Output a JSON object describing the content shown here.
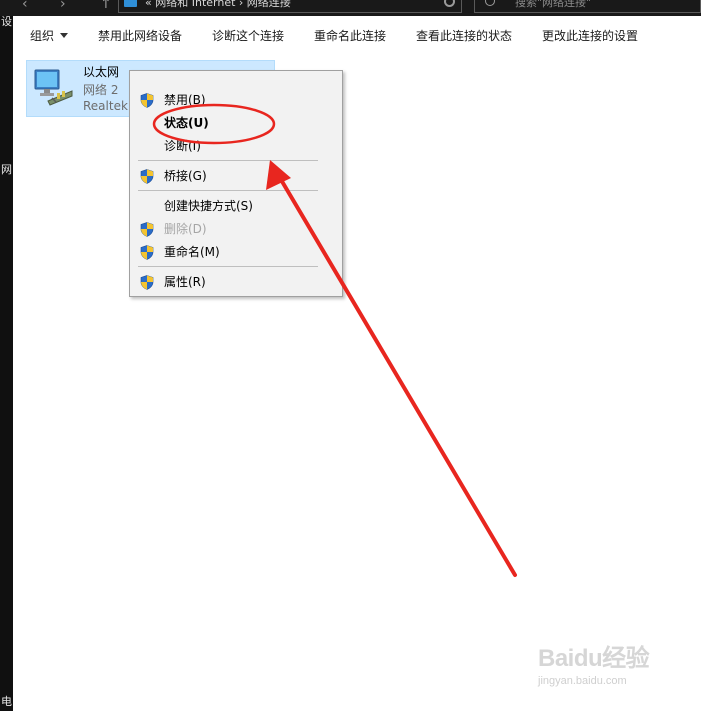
{
  "window": {
    "breadcrumb": "« 网络和 Internet › 网络连接",
    "search_placeholder": "搜索\"网络连接\"",
    "nav_back": "‹",
    "nav_forward": "›",
    "nav_up": "↑"
  },
  "left_strip": [
    "设",
    "网",
    "电"
  ],
  "toolbar": {
    "organize": "组织",
    "disable": "禁用此网络设备",
    "diagnose": "诊断这个连接",
    "rename": "重命名此连接",
    "view_status": "查看此连接的状态",
    "change_settings": "更改此连接的设置"
  },
  "adapter": {
    "name": "以太网",
    "network": "网络 2",
    "device": "Realtek PC"
  },
  "context_menu": {
    "items": [
      {
        "label": "禁用(B)",
        "icon": "uac-shield-icon"
      },
      {
        "label": "状态(U)"
      },
      {
        "label": "诊断(I)"
      },
      {
        "label": "桥接(G)",
        "icon": "uac-shield-icon"
      },
      {
        "label": "创建快捷方式(S)"
      },
      {
        "label": "删除(D)",
        "icon": "uac-shield-icon"
      },
      {
        "label": "重命名(M)",
        "icon": "uac-shield-icon"
      },
      {
        "label": "属性(R)",
        "icon": "uac-shield-icon"
      }
    ]
  },
  "annotation": {
    "color": "#e8261f"
  },
  "watermark": {
    "logo": "Baidu经验",
    "url": "jingyan.baidu.com"
  }
}
